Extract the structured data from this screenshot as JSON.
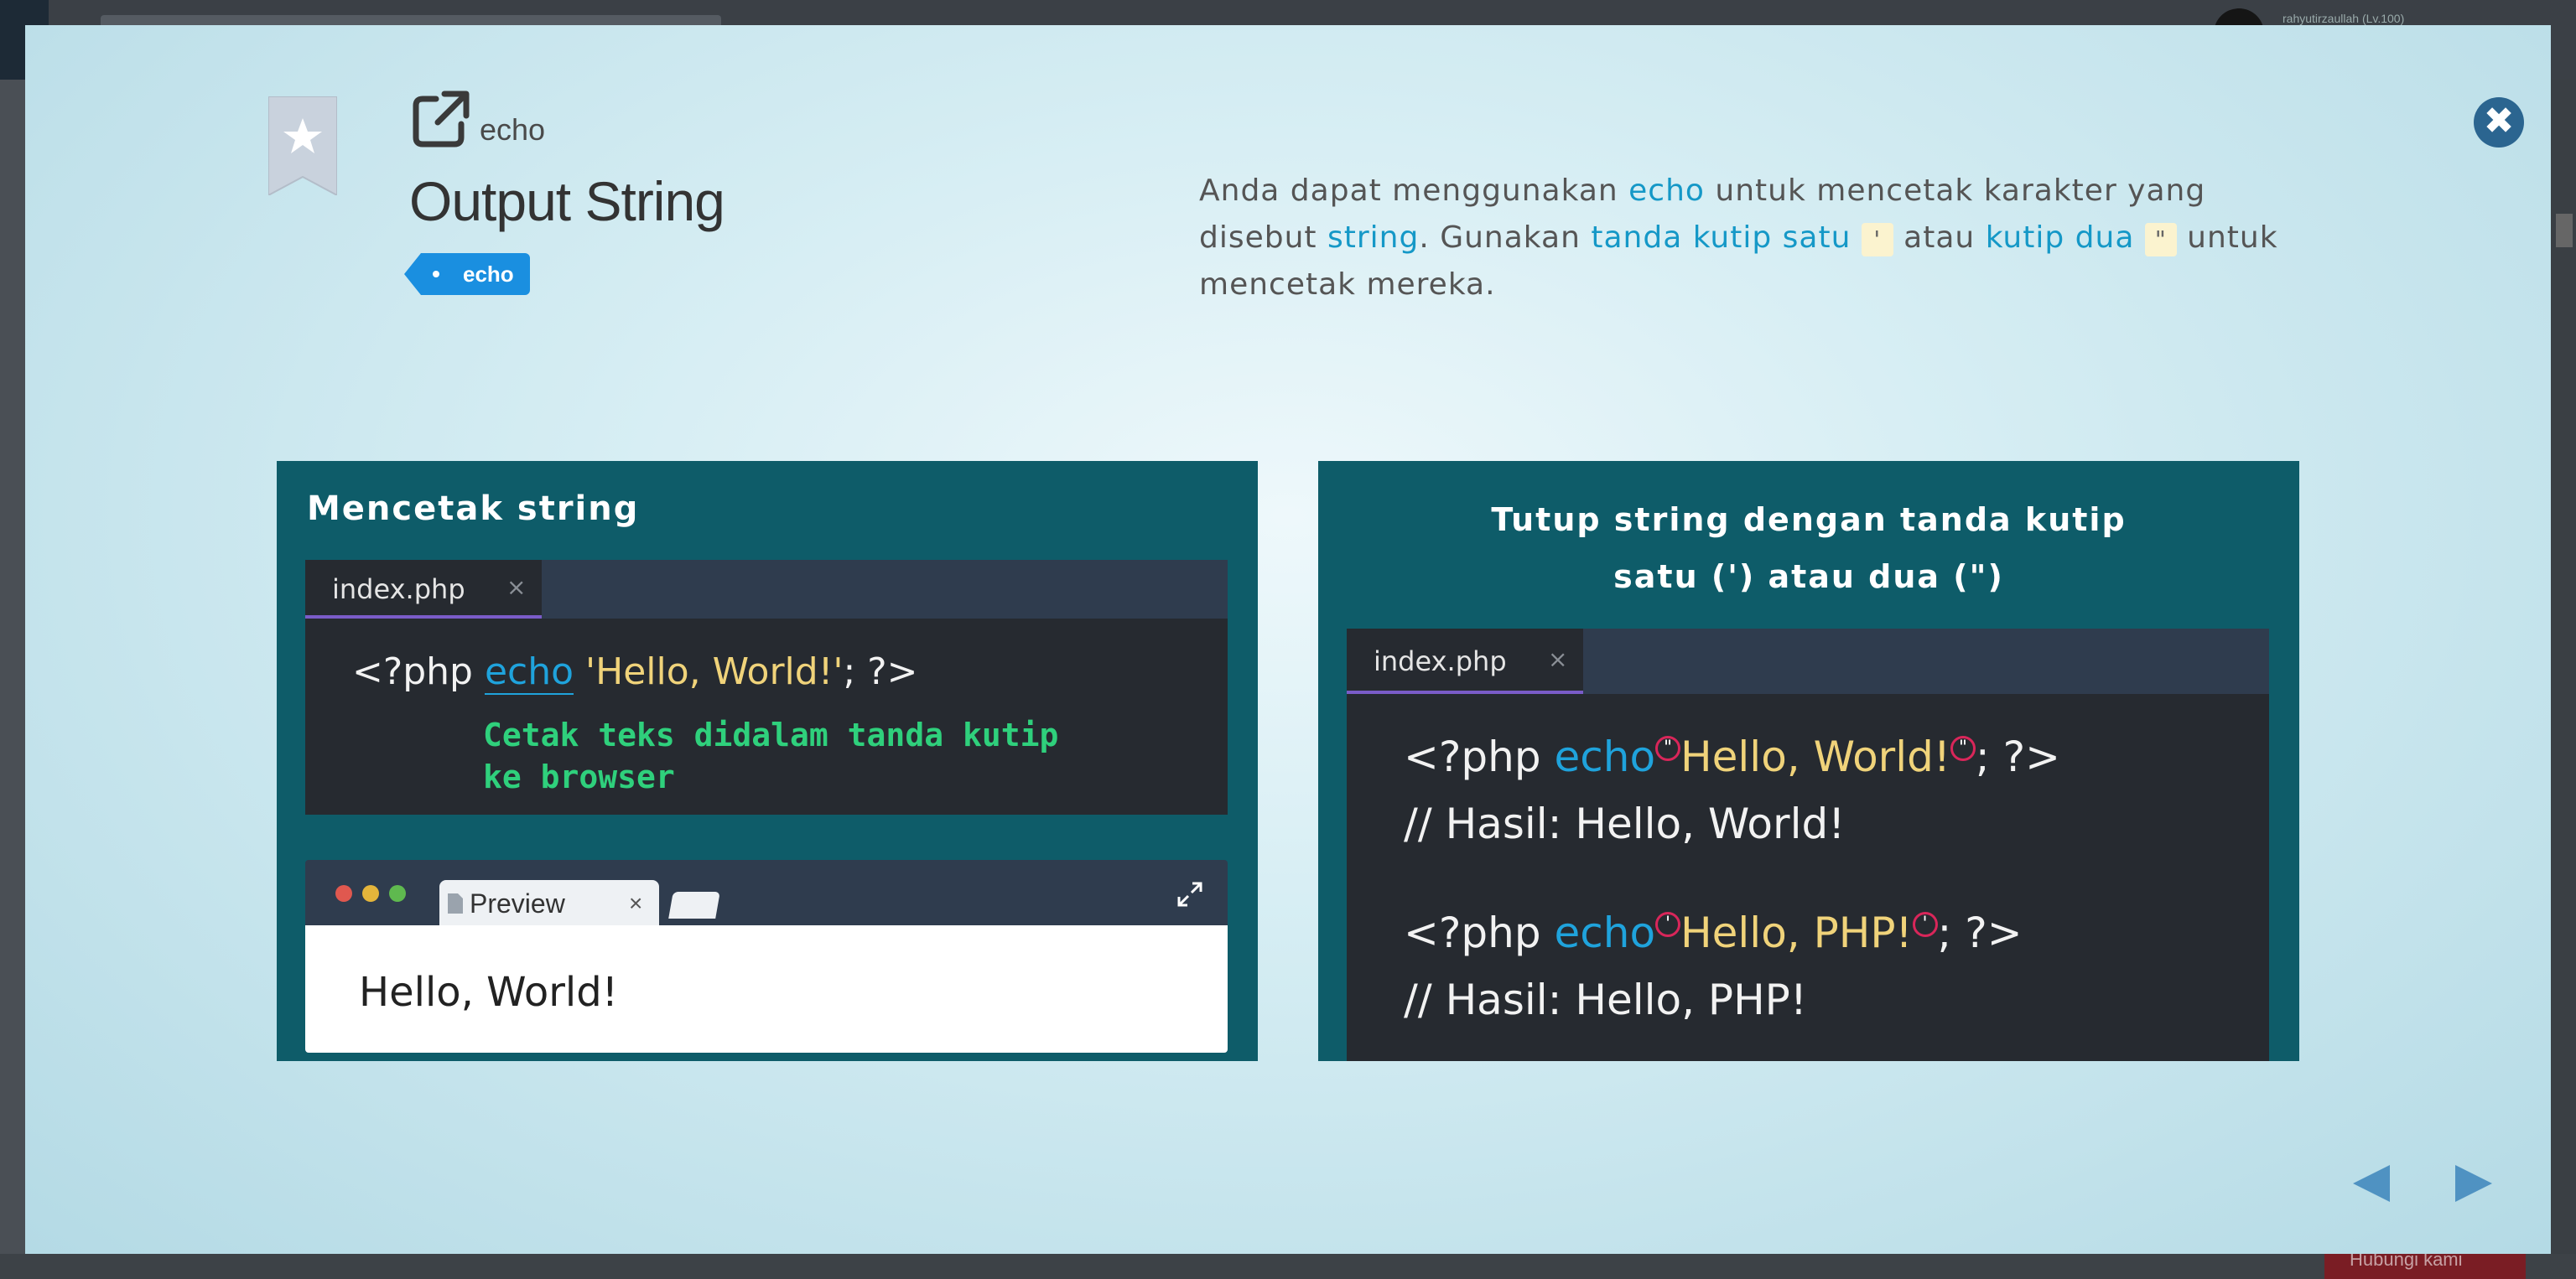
{
  "background": {
    "username": "rahyutirzaullah (Lv.100)",
    "help_button": "Hubungi kami"
  },
  "lesson": {
    "keyword": "echo",
    "title": "Output String",
    "tag": "echo",
    "description": {
      "p1": "Anda dapat menggunakan ",
      "kw_echo": "echo",
      "p2": " untuk mencetak karakter yang disebut ",
      "kw_string": "string",
      "p3": ". Gunakan ",
      "kw_single": "tanda kutip satu",
      "q_single": "'",
      "p4": " atau ",
      "kw_double": "kutip dua",
      "q_double": "\"",
      "p5": " untuk mencetak mereka."
    }
  },
  "panel_left": {
    "heading": "Mencetak string",
    "tab": "index.php",
    "tab_close": "×",
    "code": {
      "open": "<?php ",
      "echo": "echo",
      "string": " 'Hello, World!'",
      "close": "; ?>"
    },
    "note_line1": "Cetak teks didalam tanda kutip",
    "note_line2": "ke browser",
    "preview_tab": "Preview",
    "preview_close": "×",
    "output": "Hello, World!"
  },
  "panel_right": {
    "heading_line1": "Tutup string dengan tanda kutip",
    "heading_line2": "satu (') atau dua (\")",
    "tab": "index.php",
    "tab_close": "×",
    "code1": {
      "open": "<?php ",
      "echo": "echo",
      "mark": "\"",
      "string": "Hello, World!",
      "close": "; ?>"
    },
    "comment1": "// Hasil: Hello, World!",
    "code2": {
      "open": "<?php ",
      "echo": "echo",
      "mark": "'",
      "string": "Hello, PHP!",
      "close": "; ?>"
    },
    "comment2": "// Hasil: Hello, PHP!"
  },
  "modal": {
    "close_symbol": "✖"
  },
  "icons": [
    "bookmark-star-icon",
    "external-link-icon",
    "close-icon",
    "expand-icon",
    "file-icon",
    "prev-arrow-icon",
    "next-arrow-icon"
  ],
  "colors": {
    "panel_bg": "#0e5c69",
    "editor_bg": "#262a30",
    "echo_keyword": "#1fa3dc",
    "string_literal": "#f0d37a",
    "note_green": "#2fd07c",
    "tag_blue": "#1a8fe0",
    "close_button": "#2b6590"
  }
}
